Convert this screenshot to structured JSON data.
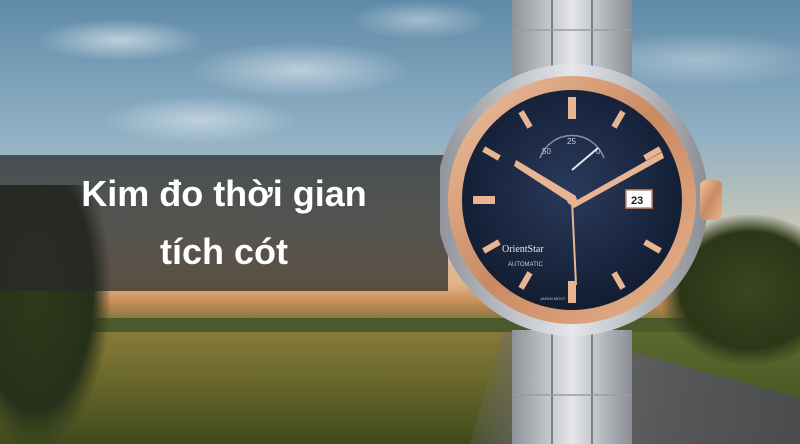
{
  "banner": {
    "line1": "Kim đo thời gian",
    "line2": "tích cót"
  },
  "watch": {
    "brand": "OrientStar",
    "model_text": "AUTOMATIC",
    "date": "23",
    "power_reserve_labels": [
      "50",
      "25",
      "0"
    ],
    "origin_text": "JAPAN MOVT"
  },
  "colors": {
    "dial": "#1c2a44",
    "rose_gold": "#d9a27d",
    "steel": "#c9ccd1",
    "banner_bg": "#282828",
    "banner_text": "#ffffff"
  }
}
